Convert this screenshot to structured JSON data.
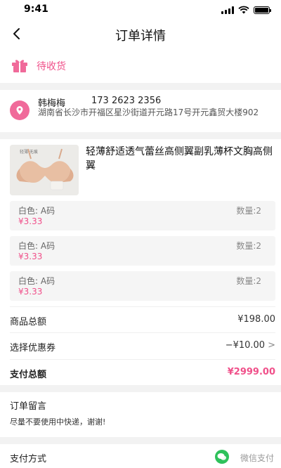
{
  "status_bar": {
    "time": "9:41",
    "battery_level": 1.0
  },
  "nav": {
    "title": "订单详情",
    "back_icon": "chevron-left-icon"
  },
  "order_status": {
    "icon": "gift-icon",
    "text": "待收货",
    "color": "#f0508a"
  },
  "address": {
    "icon": "location-pin-icon",
    "name": "韩梅梅",
    "phone": "173 2623 2356",
    "detail": "湖南省长沙市开福区星沙街道开元路17号开元鑫贸大楼902"
  },
  "product": {
    "image_icon": "bra-product-image",
    "image_caption": "轻薄·无痕",
    "title": "轻薄舒适透气蕾丝高侧翼副乳薄杯文胸高侧翼",
    "skus": [
      {
        "spec": "白色: A码",
        "price": "¥3.33",
        "qty": "数量:2"
      },
      {
        "spec": "白色: A码",
        "price": "¥3.33",
        "qty": "数量:2"
      },
      {
        "spec": "白色: A码",
        "price": "¥3.33",
        "qty": "数量:2"
      }
    ]
  },
  "summary": {
    "goods_total_label": "商品总额",
    "goods_total_value": "¥198.00",
    "coupon_label": "选择优惠券",
    "coupon_value": "−¥10.00",
    "coupon_chevron": ">",
    "pay_total_label": "支付总额",
    "pay_total_value": "¥2999.00"
  },
  "note": {
    "title": "订单留言",
    "text": "尽量不要使用中快递，谢谢!"
  },
  "payment": {
    "label": "支付方式",
    "icon": "wechat-icon",
    "value": "微信支付",
    "brand_color": "#2ec15b"
  },
  "colors": {
    "accent": "#f0508a",
    "page_bg": "#f2f2f2"
  }
}
